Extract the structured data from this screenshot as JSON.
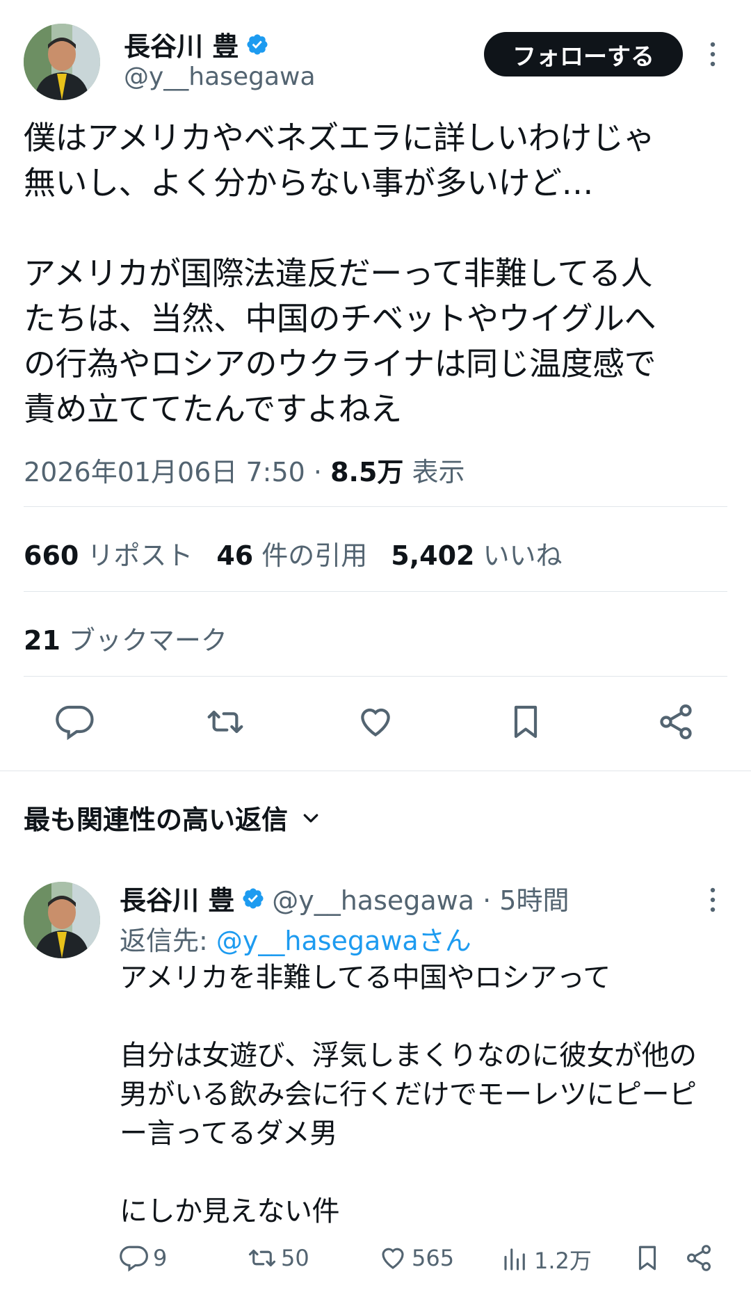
{
  "tweet": {
    "author_name": "長谷川 豊",
    "author_handle": "@y__hasegawa",
    "follow_label": "フォローする",
    "text": "僕はアメリカやベネズエラに詳しいわけじゃ\n無いし、よく分からない事が多いけど…\n\nアメリカが国際法違反だーって非難してる人\nたちは、当然、中国のチベットやウイグルへ\nの行為やロシアのウクライナは同じ温度感で\n責め立ててたんですよねえ",
    "datetime": "2026年01月06日 7:50",
    "separator": "·",
    "views_count": "8.5万",
    "views_label": "表示",
    "reposts_count": "660",
    "reposts_label": "リポスト",
    "quotes_count": "46",
    "quotes_label": "件の引用",
    "likes_count": "5,402",
    "likes_label": "いいね",
    "bookmarks_count": "21",
    "bookmarks_label": "ブックマーク"
  },
  "actions": [
    "reply-icon",
    "repost-icon",
    "like-icon",
    "bookmark-icon",
    "share-icon"
  ],
  "replies_sort_label": "最も関連性の高い返信",
  "reply": {
    "author_name": "長谷川 豊",
    "handle_time": "@y__hasegawa · 5時間",
    "reply_to_label": "返信先: ",
    "reply_to_handle": "@y__hasegawaさん",
    "text": "アメリカを非難してる中国やロシアって\n\n自分は女遊び、浮気しまくりなのに彼女が他の\n男がいる飲み会に行くだけでモーレツにピーピ\nー言ってるダメ男\n\nにしか見えない件",
    "replies": "9",
    "reposts": "50",
    "likes": "565",
    "views": "1.2万"
  },
  "colors": {
    "text": "#0f1419",
    "secondary": "#536471",
    "link": "#1d9bf0",
    "verified": "#1d9bf0",
    "button_bg": "#0f1419"
  }
}
